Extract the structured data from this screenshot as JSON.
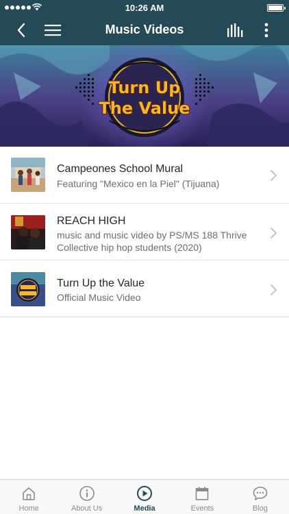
{
  "status_bar": {
    "time": "10:26 AM"
  },
  "nav": {
    "title": "Music Videos"
  },
  "banner": {
    "title_line1": "Turn Up",
    "title_line2": "The Value"
  },
  "videos": [
    {
      "title": "Campeones School Mural",
      "subtitle": "Featuring \"Mexico en la Piel\" (Tijuana)"
    },
    {
      "title": "REACH HIGH",
      "subtitle": "music and music video by PS/MS 188 Thrive Collective hip hop students (2020)"
    },
    {
      "title": "Turn Up the Value",
      "subtitle": "Official Music Video"
    }
  ],
  "tabs": [
    {
      "label": "Home"
    },
    {
      "label": "About Us"
    },
    {
      "label": "Media",
      "active": true
    },
    {
      "label": "Events"
    },
    {
      "label": "Blog"
    }
  ],
  "colors": {
    "header": "#234a56",
    "active_tab": "#234a56",
    "inactive_tab": "#8a8a8a"
  }
}
